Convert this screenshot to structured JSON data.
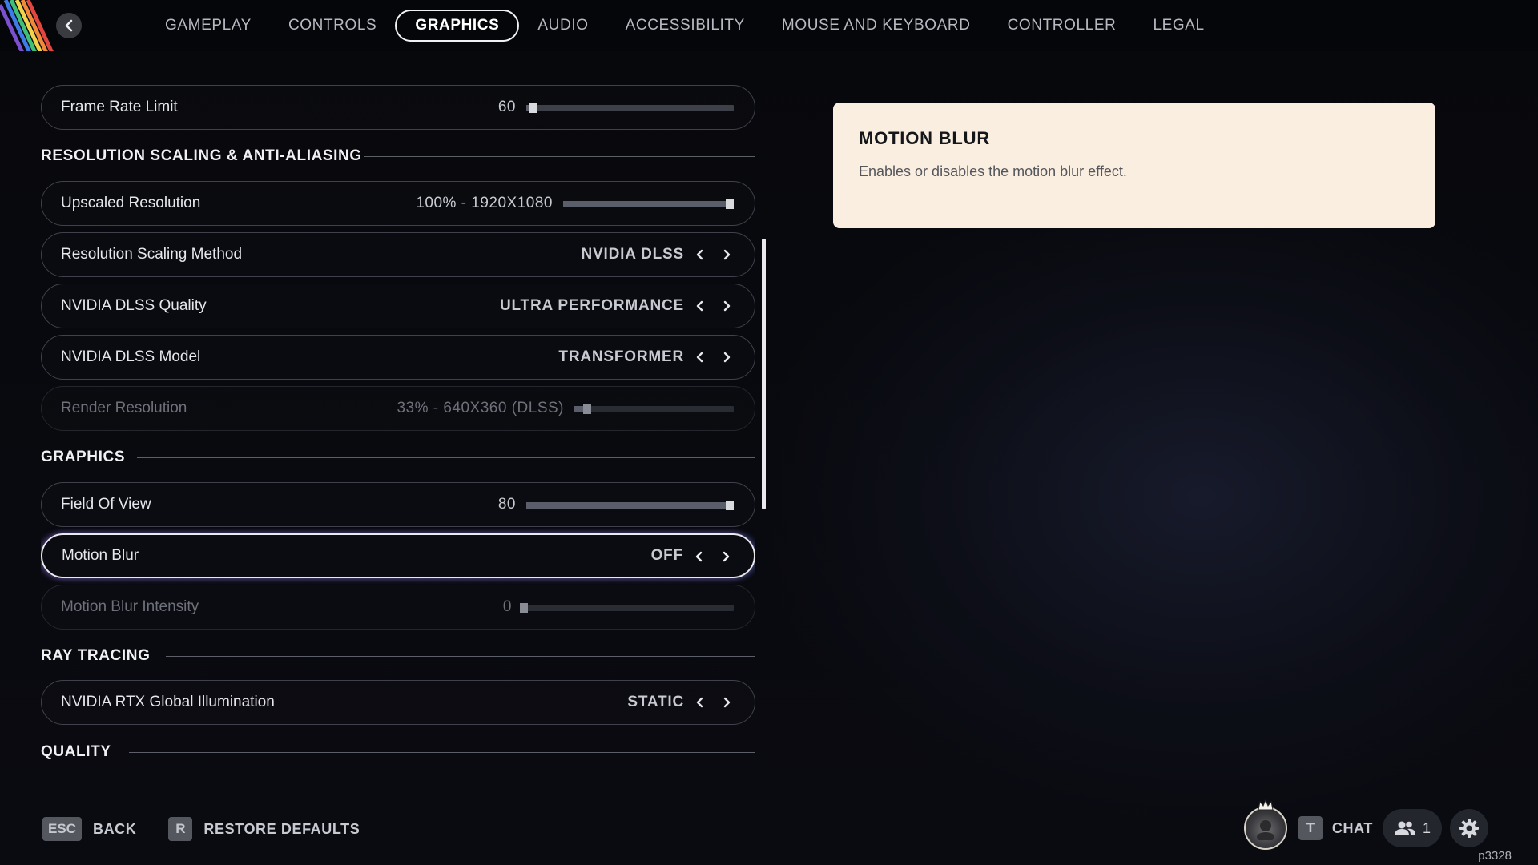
{
  "nav": {
    "tabs": [
      {
        "label": "GAMEPLAY"
      },
      {
        "label": "CONTROLS"
      },
      {
        "label": "GRAPHICS"
      },
      {
        "label": "AUDIO"
      },
      {
        "label": "ACCESSIBILITY"
      },
      {
        "label": "MOUSE AND KEYBOARD"
      },
      {
        "label": "CONTROLLER"
      },
      {
        "label": "LEGAL"
      }
    ],
    "active_tab": "GRAPHICS"
  },
  "settings": {
    "frame_rate_limit": {
      "label": "Frame Rate Limit",
      "value": "60",
      "level": 0.03
    },
    "section_resolution": "RESOLUTION SCALING & ANTI-ALIASING",
    "upscaled_resolution": {
      "label": "Upscaled Resolution",
      "value": "100% - 1920X1080",
      "level": 1.0
    },
    "resolution_scaling_method": {
      "label": "Resolution Scaling Method",
      "value": "NVIDIA DLSS"
    },
    "dlss_quality": {
      "label": "NVIDIA DLSS Quality",
      "value": "ULTRA PERFORMANCE"
    },
    "dlss_model": {
      "label": "NVIDIA DLSS Model",
      "value": "TRANSFORMER"
    },
    "render_resolution": {
      "label": "Render Resolution",
      "value": "33% - 640X360 (DLSS)",
      "level": 0.08,
      "disabled": true
    },
    "section_graphics": "GRAPHICS",
    "field_of_view": {
      "label": "Field Of View",
      "value": "80",
      "level": 1.0
    },
    "motion_blur": {
      "label": "Motion Blur",
      "value": "OFF",
      "focused": true
    },
    "motion_blur_intensity": {
      "label": "Motion Blur Intensity",
      "value": "0",
      "level": 0.0,
      "disabled": true
    },
    "section_ray_tracing": "RAY TRACING",
    "rtx_gi": {
      "label": "NVIDIA RTX Global Illumination",
      "value": "STATIC"
    },
    "section_quality": "QUALITY"
  },
  "description": {
    "title": "MOTION BLUR",
    "text": "Enables or disables the motion blur effect."
  },
  "footer": {
    "back_key": "ESC",
    "back_label": "BACK",
    "restore_key": "R",
    "restore_label": "RESTORE DEFAULTS",
    "chat_key": "T",
    "chat_label": "CHAT",
    "friends_count": "1",
    "build_id": "p3328"
  },
  "colors": {
    "card_bg": "#faeee1",
    "accent_white": "#f1f1f4",
    "row_border": "#3f424c"
  },
  "icons": {
    "back": "chevron-left-icon",
    "prev": "chevron-left-icon",
    "next": "chevron-right-icon",
    "friends": "people-icon",
    "settings": "gear-icon",
    "logo": "rainbow-stripes-logo"
  }
}
